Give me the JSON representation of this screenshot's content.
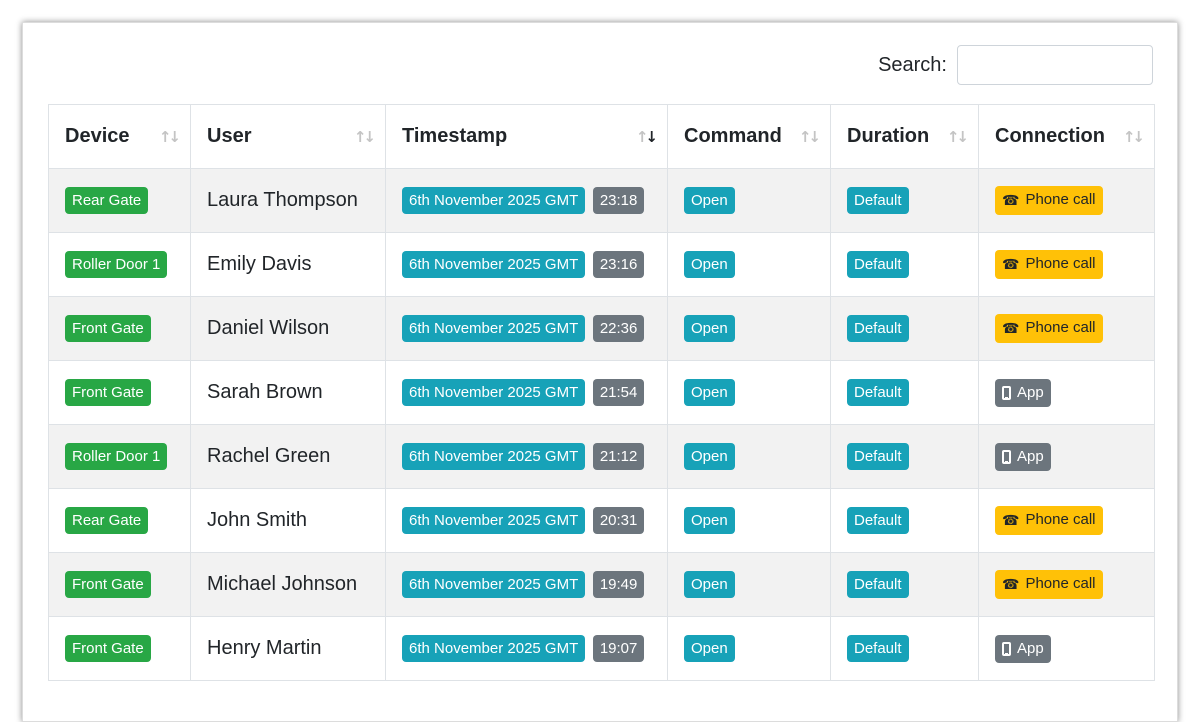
{
  "search": {
    "label": "Search:",
    "value": "",
    "placeholder": ""
  },
  "columns": [
    "Device",
    "User",
    "Timestamp",
    "Command",
    "Duration",
    "Connection"
  ],
  "sorted_column": "Timestamp",
  "sort_direction": "descending",
  "rows": [
    {
      "device": "Rear Gate",
      "user": "Laura Thompson",
      "date": "6th November 2025 GMT",
      "time": "23:18",
      "command": "Open",
      "duration": "Default",
      "connection": "Phone call",
      "connection_icon": "phone-icon"
    },
    {
      "device": "Roller Door 1",
      "user": "Emily Davis",
      "date": "6th November 2025 GMT",
      "time": "23:16",
      "command": "Open",
      "duration": "Default",
      "connection": "Phone call",
      "connection_icon": "phone-icon"
    },
    {
      "device": "Front Gate",
      "user": "Daniel Wilson",
      "date": "6th November 2025 GMT",
      "time": "22:36",
      "command": "Open",
      "duration": "Default",
      "connection": "Phone call",
      "connection_icon": "phone-icon"
    },
    {
      "device": "Front Gate",
      "user": "Sarah Brown",
      "date": "6th November 2025 GMT",
      "time": "21:54",
      "command": "Open",
      "duration": "Default",
      "connection": "App",
      "connection_icon": "mobile-icon"
    },
    {
      "device": "Roller Door 1",
      "user": "Rachel Green",
      "date": "6th November 2025 GMT",
      "time": "21:12",
      "command": "Open",
      "duration": "Default",
      "connection": "App",
      "connection_icon": "mobile-icon"
    },
    {
      "device": "Rear Gate",
      "user": "John Smith",
      "date": "6th November 2025 GMT",
      "time": "20:31",
      "command": "Open",
      "duration": "Default",
      "connection": "Phone call",
      "connection_icon": "phone-icon"
    },
    {
      "device": "Front Gate",
      "user": "Michael Johnson",
      "date": "6th November 2025 GMT",
      "time": "19:49",
      "command": "Open",
      "duration": "Default",
      "connection": "Phone call",
      "connection_icon": "phone-icon"
    },
    {
      "device": "Front Gate",
      "user": "Henry Martin",
      "date": "6th November 2025 GMT",
      "time": "19:07",
      "command": "Open",
      "duration": "Default",
      "connection": "App",
      "connection_icon": "mobile-icon"
    }
  ],
  "colors": {
    "device_badge": "#28a745",
    "info_badge": "#17a2b8",
    "time_badge": "#6c757d",
    "phone_badge": "#ffc107",
    "app_badge": "#6c757d",
    "striped_row": "#f2f2f2"
  }
}
